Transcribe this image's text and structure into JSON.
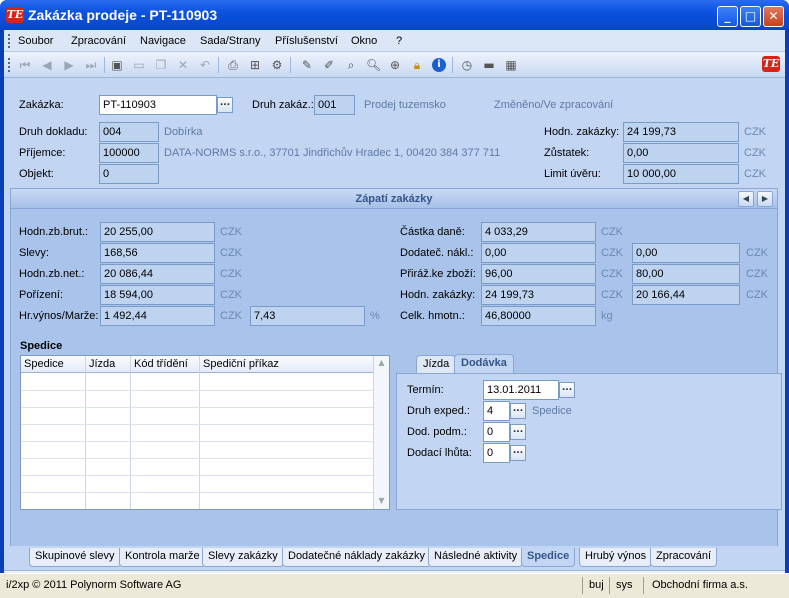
{
  "window": {
    "title": "Zakázka prodeje - PT-110903",
    "logo": "TE"
  },
  "menu": [
    "Soubor",
    "Zpracování",
    "Navigace",
    "Sada/Strany",
    "Příslušenství",
    "Okno",
    "?"
  ],
  "header": {
    "zakazka_label": "Zakázka:",
    "zakazka_value": "PT-110903",
    "druh_zakaz_label": "Druh zakáz.:",
    "druh_zakaz_value": "001",
    "druh_zakaz_text": "Prodej tuzemsko",
    "status": "Změněno/Ve zpracování",
    "druh_dokladu_label": "Druh dokladu:",
    "druh_dokladu_value": "004",
    "druh_dokladu_text": "Dobírka",
    "prijemce_label": "Příjemce:",
    "prijemce_value": "100000",
    "prijemce_text": "DATA-NORMS s.r.o., 37701 Jindřichův Hradec 1, 00420 384 377 711",
    "objekt_label": "Objekt:",
    "objekt_value": "0",
    "hodn_zakazky_label": "Hodn. zakázky:",
    "hodn_zakazky_value": "24 199,73",
    "zustatek_label": "Zůstatek:",
    "zustatek_value": "0,00",
    "limit_label": "Limit úvěru:",
    "limit_value": "10 000,00",
    "currency": "CZK"
  },
  "footer": {
    "title": "Zápatí zakázky",
    "hodn_zb_brut_label": "Hodn.zb.brut.:",
    "hodn_zb_brut": "20 255,00",
    "slevy_label": "Slevy:",
    "slevy": "168,56",
    "hodn_zb_net_label": "Hodn.zb.net.:",
    "hodn_zb_net": "20 086,44",
    "porizeni_label": "Pořízení:",
    "porizeni": "18 594,00",
    "hr_vynos_label": "Hr.výnos/Marže:",
    "hr_vynos": "1 492,44",
    "marze": "7,43",
    "percent": "%",
    "castka_dane_label": "Částka daně:",
    "castka_dane": "4 033,29",
    "dodatec_nakl_label": "Dodateč. nákl.:",
    "dodatec_nakl": "0,00",
    "dodatec_nakl2": "0,00",
    "priraz_label": "Přiráž.ke zboží:",
    "priraz": "96,00",
    "priraz2": "80,00",
    "hodn_zak_label": "Hodn. zakázky:",
    "hodn_zak": "24 199,73",
    "hodn_zak2": "20 166,44",
    "celk_hmotn_label": "Celk. hmotn.:",
    "celk_hmotn": "46,80000",
    "kg": "kg",
    "currency": "CZK"
  },
  "spedice": {
    "title": "Spedice",
    "columns": [
      "Spedice",
      "Jízda",
      "Kód třídění",
      "Spediční příkaz"
    ]
  },
  "tabs": {
    "inner": [
      "Jízda",
      "Dodávka"
    ],
    "termin_label": "Termín:",
    "termin": "13.01.2011",
    "druh_exped_label": "Druh exped.:",
    "druh_exped": "4",
    "druh_exped_text": "Spedice",
    "dod_podm_label": "Dod. podm.:",
    "dod_podm": "0",
    "dodaci_lhuta_label": "Dodací lhůta:",
    "dodaci_lhuta": "0"
  },
  "bottom_tabs": [
    "Skupinové slevy",
    "Kontrola marže",
    "Slevy zakázky",
    "Dodatečné náklady zakázky",
    "Následné aktivity",
    "Spedice",
    "Hrubý výnos",
    "Zpracování"
  ],
  "status": {
    "copyright": "i/2xp © 2011 Polynorm Software AG",
    "user": "buj",
    "system": "sys",
    "company": "Obchodní firma a.s."
  }
}
